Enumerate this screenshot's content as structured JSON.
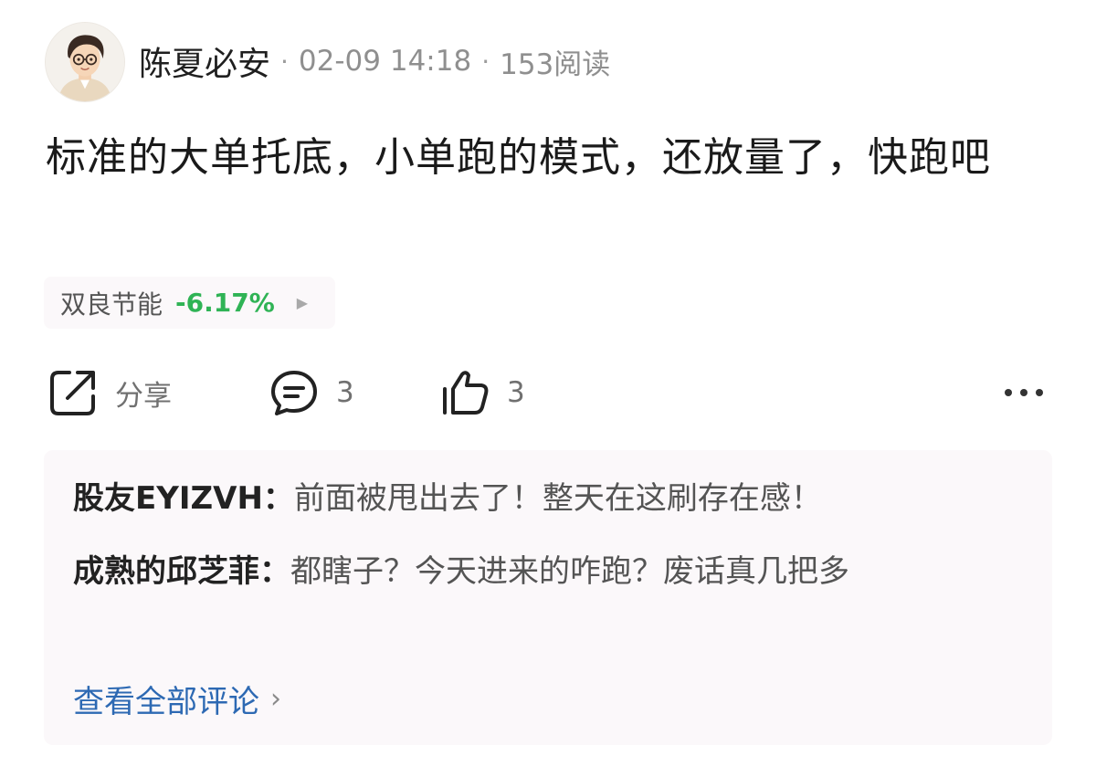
{
  "post": {
    "author": "陈夏必安",
    "time": "02-09 14:18",
    "reads": "153阅读",
    "content": "标准的大单托底，小单跑的模式，还放量了，快跑吧"
  },
  "stock": {
    "name": "双良节能",
    "change": "-6.17%",
    "arrow": "▶",
    "change_color": "#2fb355"
  },
  "actions": {
    "share_label": "分享",
    "comment_count": "3",
    "like_count": "3"
  },
  "comments": {
    "items": [
      {
        "user": "股友EYIZVH：",
        "text": "前面被甩出去了！整天在这刷存在感！"
      },
      {
        "user": "成熟的邱芝菲：",
        "text": "都瞎子？今天进来的咋跑？废话真几把多"
      }
    ],
    "view_all": "查看全部评论",
    "view_all_arrow": "›",
    "link_color": "#2d69b3"
  },
  "icons": {
    "share": "share-icon",
    "comment": "comment-icon",
    "like": "thumbs-up-icon",
    "more": "more-dots-icon"
  }
}
